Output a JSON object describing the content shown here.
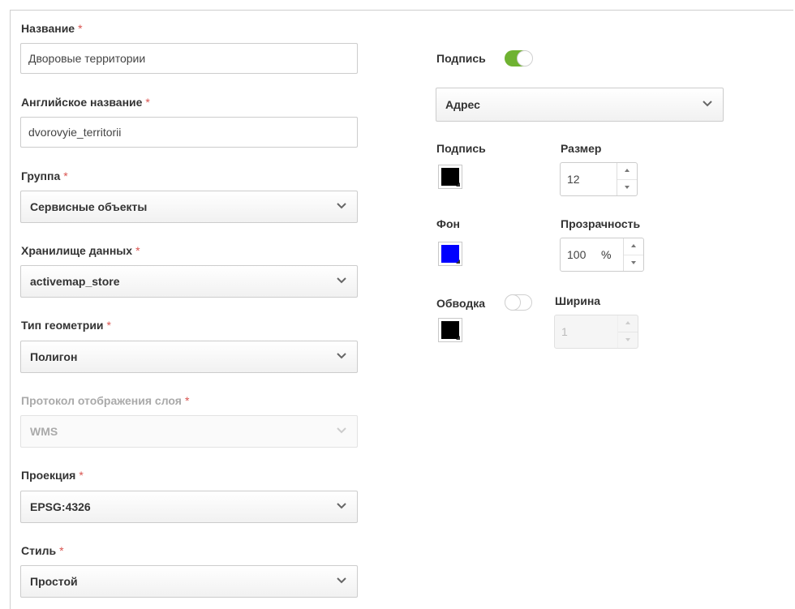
{
  "required_mark": "*",
  "left": {
    "name": {
      "label": "Название",
      "value": "Дворовые территории"
    },
    "english_name": {
      "label": "Английское название",
      "value": "dvorovyie_territorii"
    },
    "group": {
      "label": "Группа",
      "value": "Сервисные объекты"
    },
    "storage": {
      "label": "Хранилище данных",
      "value": "activemap_store"
    },
    "geometry": {
      "label": "Тип геометрии",
      "value": "Полигон"
    },
    "protocol": {
      "label": "Протокол отображения слоя",
      "value": "WMS",
      "disabled": true
    },
    "projection": {
      "label": "Проекция",
      "value": "EPSG:4326"
    },
    "style": {
      "label": "Стиль",
      "value": "Простой"
    }
  },
  "right": {
    "label_toggle": {
      "label": "Подпись",
      "on": true,
      "color": "#6fb231"
    },
    "label_field": {
      "value": "Адрес"
    },
    "text_color": {
      "label": "Подпись",
      "color": "#000000"
    },
    "size": {
      "label": "Размер",
      "value": "12"
    },
    "bg_color": {
      "label": "Фон",
      "color": "#0000ff"
    },
    "opacity": {
      "label": "Прозрачность",
      "value": "100",
      "unit": "%"
    },
    "stroke": {
      "label": "Обводка",
      "on": false,
      "color": "#000000"
    },
    "width": {
      "label": "Ширина",
      "value": "1",
      "disabled": true
    }
  }
}
